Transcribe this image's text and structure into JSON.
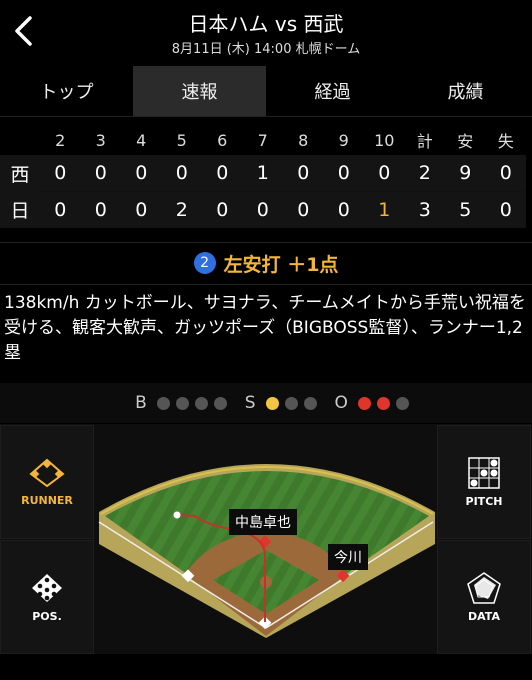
{
  "header": {
    "title": "日本ハム vs 西武",
    "subtitle": "8月11日 (木) 14:00 札幌ドーム"
  },
  "tabs": [
    {
      "label": "トップ",
      "active": false
    },
    {
      "label": "速報",
      "active": true
    },
    {
      "label": "経過",
      "active": false
    },
    {
      "label": "成績",
      "active": false
    }
  ],
  "scoreboard": {
    "headers": [
      "2",
      "3",
      "4",
      "5",
      "6",
      "7",
      "8",
      "9",
      "10",
      "計",
      "安",
      "失"
    ],
    "rows": [
      {
        "team": "西",
        "cells": [
          "0",
          "0",
          "0",
          "0",
          "0",
          "1",
          "0",
          "0",
          "0",
          "2",
          "9",
          "0"
        ]
      },
      {
        "team": "日",
        "cells": [
          "0",
          "0",
          "0",
          "2",
          "0",
          "0",
          "0",
          "0",
          "1",
          "3",
          "5",
          "0"
        ]
      }
    ]
  },
  "play": {
    "number": "2",
    "text": "左安打 ＋1点"
  },
  "description": "138km/h カットボール、サヨナラ、チームメイトから手荒い祝福を受ける、観客大歓声、ガッツポーズ（BIGBOSS監督）、ランナー1,2塁",
  "count": {
    "b_label": "B",
    "s_label": "S",
    "o_label": "O",
    "balls": 0,
    "strikes": 1,
    "outs": 2
  },
  "side_buttons": {
    "runner": "RUNNER",
    "pos": "POS.",
    "pitch": "PITCH",
    "data": "DATA"
  },
  "field": {
    "label_fielder": "中島卓也",
    "label_runner": "今川"
  },
  "colors": {
    "accent": "#f4b63a",
    "badge": "#2f6fe0",
    "strike": "#f4c542",
    "out": "#e0352b"
  }
}
